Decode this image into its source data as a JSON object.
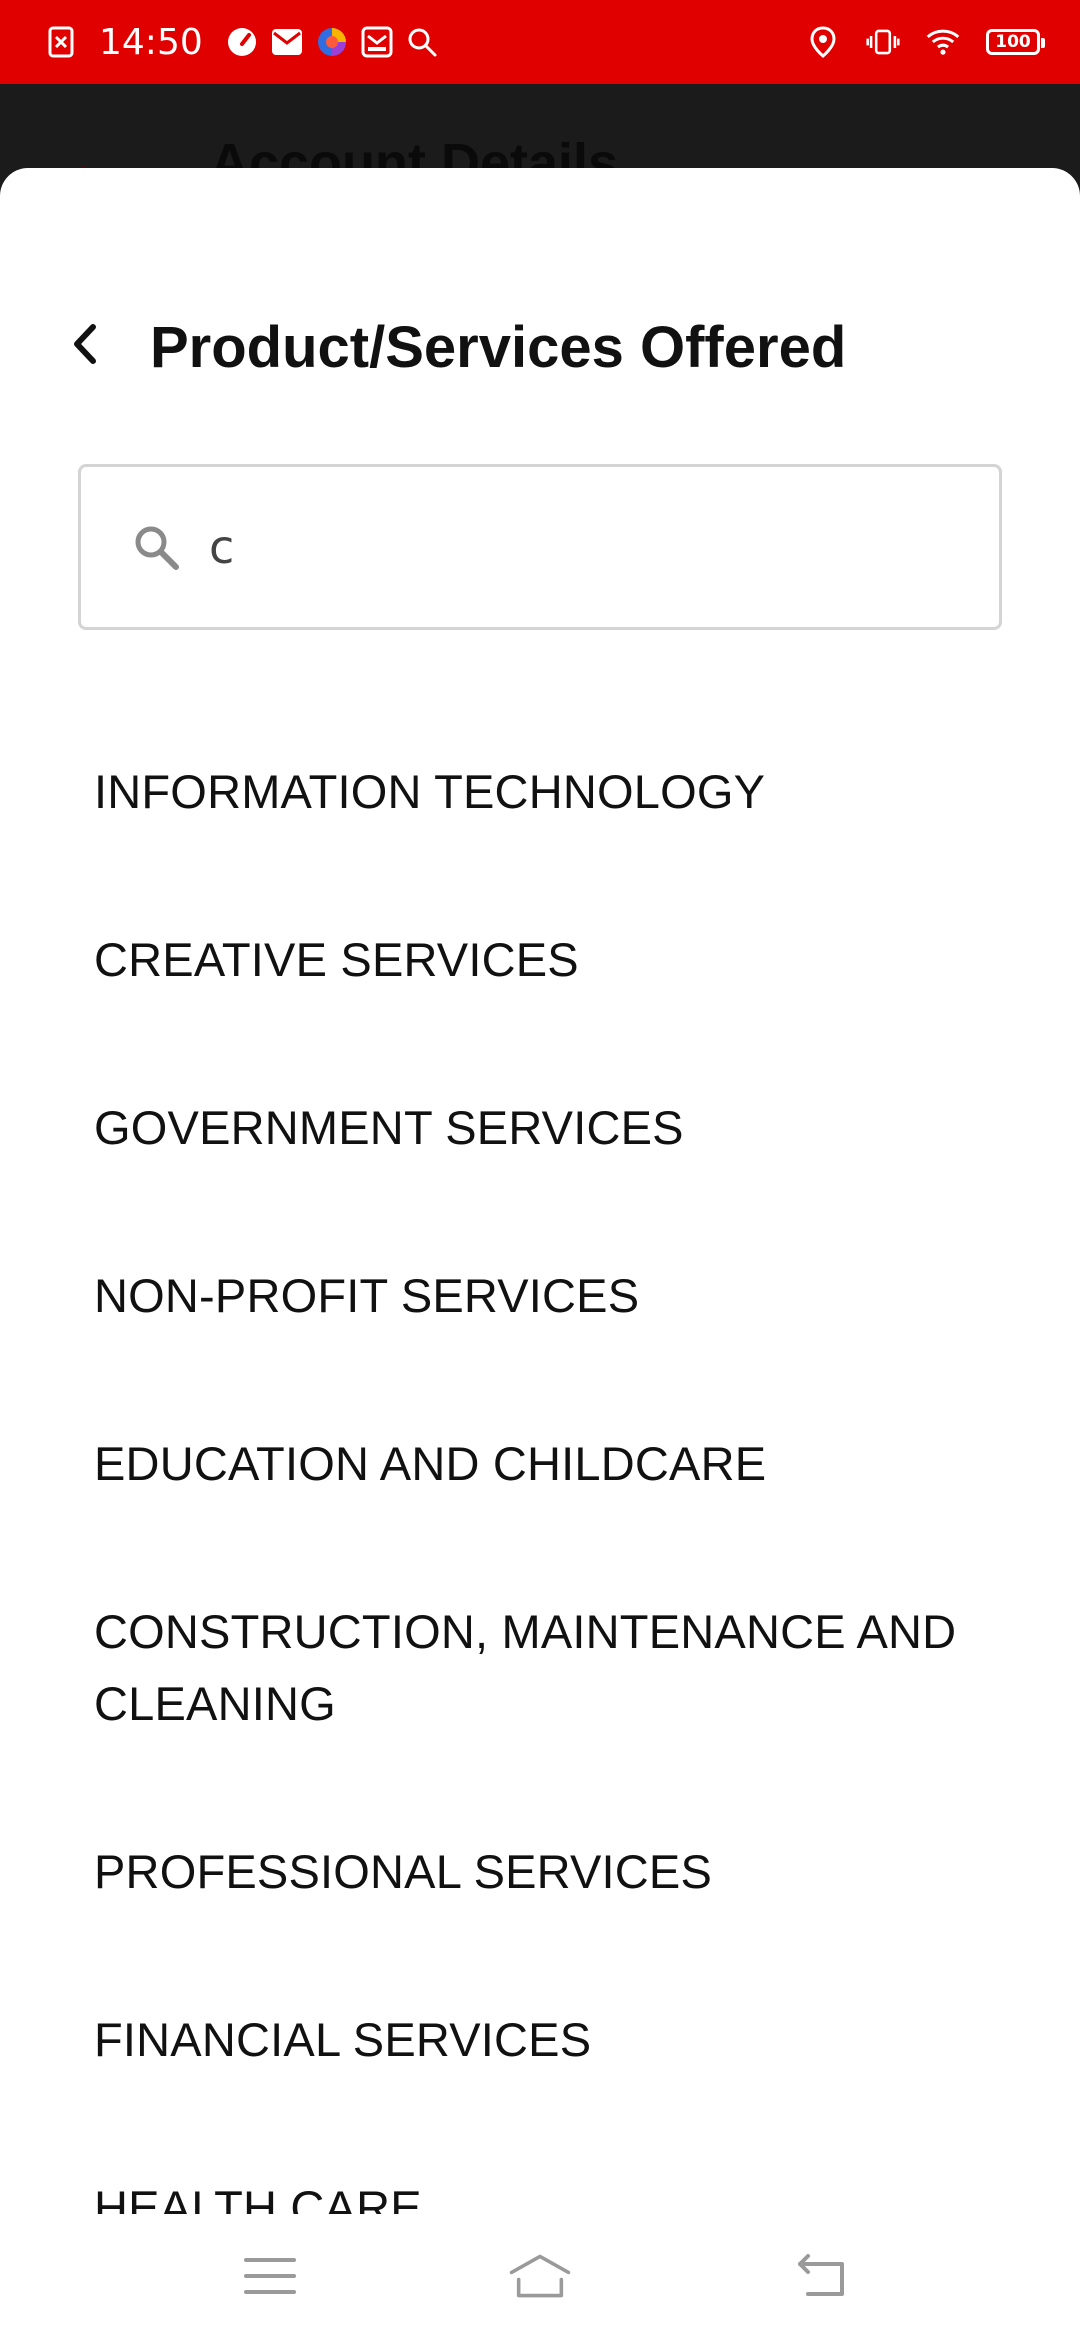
{
  "status_bar": {
    "time": "14:50",
    "battery_level": "100",
    "left_icons": [
      "notification-x-icon",
      "speedometer-icon",
      "mail-icon",
      "browser-icon",
      "inbox-icon",
      "search-icon"
    ],
    "right_icons": [
      "location-icon",
      "vibrate-icon",
      "wifi-icon",
      "battery-icon"
    ],
    "color": "#e10000"
  },
  "background_page": {
    "title": "Account Details"
  },
  "sheet": {
    "title": "Product/Services Offered",
    "search": {
      "value": "c",
      "placeholder": ""
    },
    "options": [
      "INFORMATION TECHNOLOGY",
      "CREATIVE SERVICES",
      "GOVERNMENT SERVICES",
      "NON-PROFIT SERVICES",
      "EDUCATION AND CHILDCARE",
      "CONSTRUCTION, MAINTENANCE AND CLEANING",
      "PROFESSIONAL SERVICES",
      "FINANCIAL SERVICES",
      "HEALTH CARE"
    ]
  },
  "nav_bar": {
    "buttons": [
      "menu-icon",
      "home-icon",
      "back-icon"
    ]
  }
}
